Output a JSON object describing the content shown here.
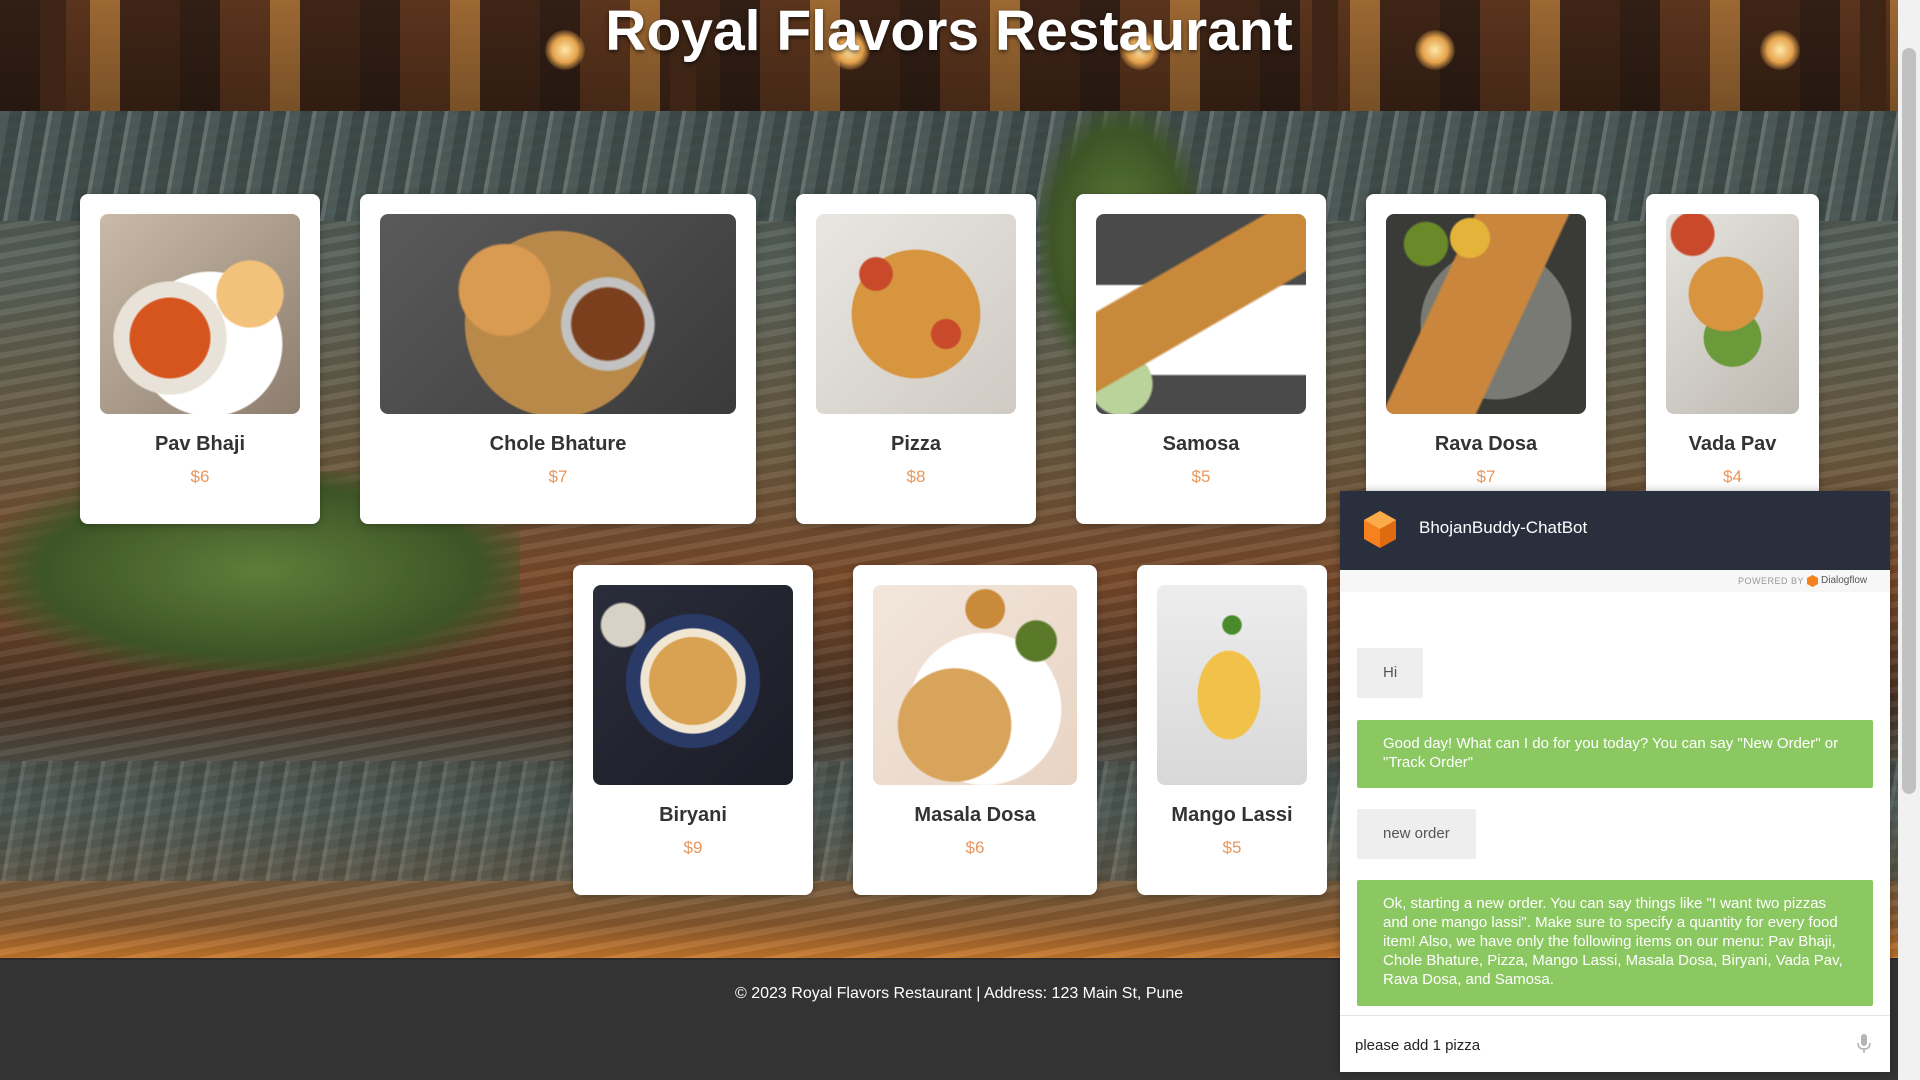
{
  "header": {
    "title": "Royal Flavors Restaurant"
  },
  "menu": {
    "row1": [
      {
        "name": "Pav Bhaji",
        "price": "$6"
      },
      {
        "name": "Chole Bhature",
        "price": "$7"
      },
      {
        "name": "Pizza",
        "price": "$8"
      },
      {
        "name": "Samosa",
        "price": "$5"
      },
      {
        "name": "Rava Dosa",
        "price": "$7"
      },
      {
        "name": "Vada Pav",
        "price": "$4"
      }
    ],
    "row2": [
      {
        "name": "Biryani",
        "price": "$9"
      },
      {
        "name": "Masala Dosa",
        "price": "$6"
      },
      {
        "name": "Mango Lassi",
        "price": "$5"
      }
    ]
  },
  "footer": {
    "text": "© 2023 Royal Flavors Restaurant | Address: 123 Main St, Pune"
  },
  "chatbot": {
    "title": "BhojanBuddy-ChatBot",
    "powered_by": "POWERED BY",
    "provider": "Dialogflow",
    "messages": [
      {
        "from": "user",
        "text": "Hi"
      },
      {
        "from": "bot",
        "text": "Good day! What can I do for you today? You can say \"New Order\" or \"Track Order\""
      },
      {
        "from": "user",
        "text": "new order"
      },
      {
        "from": "bot",
        "text": "Ok, starting a new order. You can say things like \"I want two pizzas and one mango lassi\". Make sure to specify a quantity for every food item! Also, we have only the following items on our menu: Pav Bhaji, Chole Bhature, Pizza, Mango Lassi, Masala Dosa, Biryani, Vada Pav, Rava Dosa, and Samosa."
      }
    ],
    "input_value": "please add 1 pizza"
  },
  "colors": {
    "price": "#e8975c",
    "bot_bubble": "#8bc862",
    "chat_header": "#2a2f3e",
    "footer": "#333333",
    "dialogflow_orange": "#f5821f"
  }
}
